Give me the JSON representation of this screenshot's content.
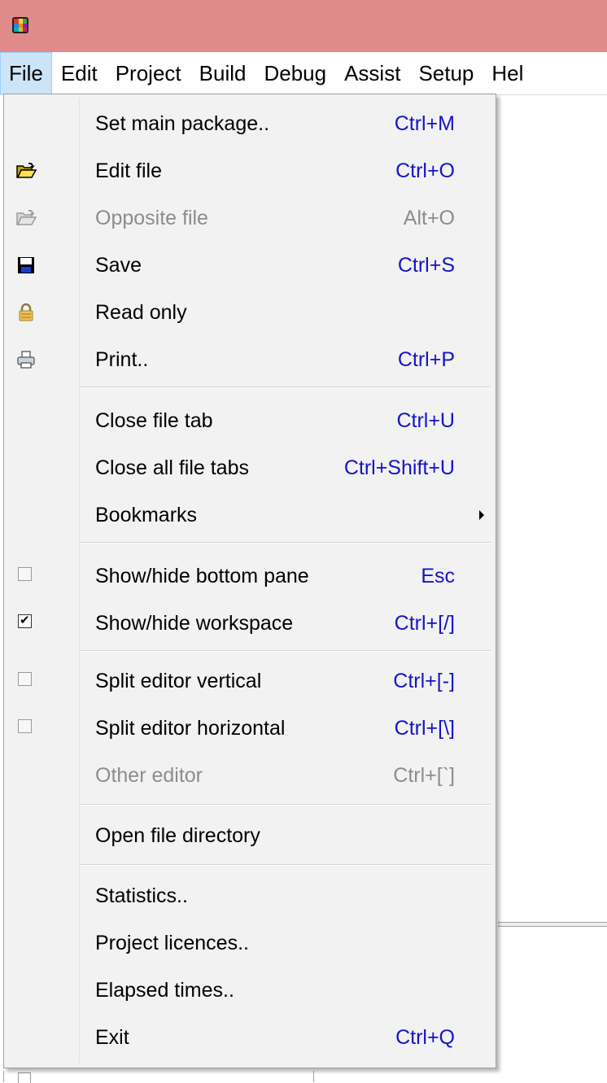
{
  "menubar": [
    "File",
    "Edit",
    "Project",
    "Build",
    "Debug",
    "Assist",
    "Setup",
    "Hel"
  ],
  "menu": {
    "items": [
      {
        "label": "Set main package..",
        "shortcut": "Ctrl+M",
        "icon": "none"
      },
      {
        "label": "Edit file",
        "shortcut": "Ctrl+O",
        "icon": "open-folder-icon"
      },
      {
        "label": "Opposite file",
        "shortcut": "Alt+O",
        "icon": "open-folder-disabled-icon",
        "disabled": true
      },
      {
        "label": "Save",
        "shortcut": "Ctrl+S",
        "icon": "floppy-disk-icon"
      },
      {
        "label": "Read only",
        "shortcut": "",
        "icon": "lock-icon"
      },
      {
        "label": "Print..",
        "shortcut": "Ctrl+P",
        "icon": "printer-icon"
      },
      {
        "label": "Close file tab",
        "shortcut": "Ctrl+U",
        "icon": "none"
      },
      {
        "label": "Close all file tabs",
        "shortcut": "Ctrl+Shift+U",
        "icon": "none"
      },
      {
        "label": "Bookmarks",
        "shortcut": "",
        "icon": "none",
        "submenu": true
      },
      {
        "label": "Show/hide bottom pane",
        "shortcut": "Esc",
        "icon": "checkbox",
        "checked": false
      },
      {
        "label": "Show/hide workspace",
        "shortcut": "Ctrl+[/]",
        "icon": "checkbox",
        "checked": true
      },
      {
        "label": "Split editor vertical",
        "shortcut": "Ctrl+[-]",
        "icon": "checkbox",
        "checked": false
      },
      {
        "label": "Split editor horizontal",
        "shortcut": "Ctrl+[\\]",
        "icon": "checkbox",
        "checked": false
      },
      {
        "label": "Other editor",
        "shortcut": "Ctrl+[`]",
        "icon": "none",
        "disabled": true
      },
      {
        "label": "Open file directory",
        "shortcut": "",
        "icon": "none"
      },
      {
        "label": "Statistics..",
        "shortcut": "",
        "icon": "none"
      },
      {
        "label": "Project licences..",
        "shortcut": "",
        "icon": "none"
      },
      {
        "label": "Elapsed times..",
        "shortcut": "",
        "icon": "none"
      },
      {
        "label": "Exit",
        "shortcut": "Ctrl+Q",
        "icon": "none"
      }
    ]
  },
  "colors": {
    "titlebar": "#e08a8a",
    "shortcut": "#1414c8",
    "disabled": "#8c8c8c",
    "menu_bg": "#f2f2f2"
  }
}
